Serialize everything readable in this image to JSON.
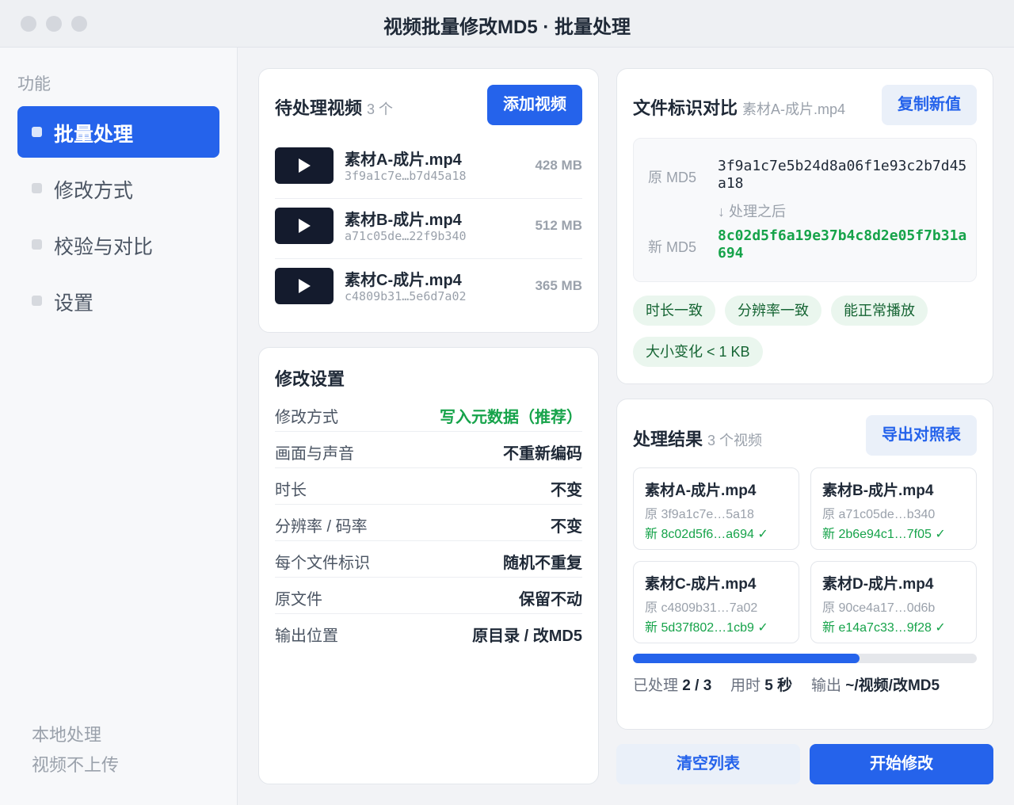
{
  "window": {
    "title": "视频批量修改MD5 · 批量处理"
  },
  "sidebar": {
    "heading": "功能",
    "items": [
      {
        "label": "批量处理",
        "active": true
      },
      {
        "label": "修改方式",
        "active": false
      },
      {
        "label": "校验与对比",
        "active": false
      },
      {
        "label": "设置",
        "active": false
      }
    ],
    "footer": [
      "本地处理",
      "视频不上传"
    ]
  },
  "queue": {
    "title": "待处理视频",
    "count": "3 个",
    "add_button": "添加视频",
    "videos": [
      {
        "name": "素材A-成片.mp4",
        "hash": "3f9a1c7e…b7d45a18",
        "size": "428 MB"
      },
      {
        "name": "素材B-成片.mp4",
        "hash": "a71c05de…22f9b340",
        "size": "512 MB"
      },
      {
        "name": "素材C-成片.mp4",
        "hash": "c4809b31…5e6d7a02",
        "size": "365 MB"
      }
    ]
  },
  "settings": {
    "title": "修改设置",
    "rows": [
      {
        "name": "修改方式",
        "value": "写入元数据（推荐）",
        "highlight": true
      },
      {
        "name": "画面与声音",
        "value": "不重新编码"
      },
      {
        "name": "时长",
        "value": "不变"
      },
      {
        "name": "分辨率 / 码率",
        "value": "不变"
      },
      {
        "name": "每个文件标识",
        "value": "随机不重复"
      },
      {
        "name": "原文件",
        "value": "保留不动"
      },
      {
        "name": "输出位置",
        "value": "原目录 / 改MD5"
      }
    ]
  },
  "compare": {
    "title": "文件标识对比",
    "file": "素材A-成片.mp4",
    "copy_button": "复制新值",
    "old_label": "原 MD5",
    "old_value": "3f9a1c7e5b24d8a06f1e93c2b7d45a18",
    "arrow_note": "↓ 处理之后",
    "new_label": "新 MD5",
    "new_value": "8c02d5f6a19e37b4c8d2e05f7b31a694",
    "checks": [
      "时长一致",
      "分辨率一致",
      "能正常播放",
      "大小变化 < 1 KB"
    ]
  },
  "results": {
    "title": "处理结果",
    "count": "3 个视频",
    "export_button": "导出对照表",
    "items": [
      {
        "name": "素材A-成片.mp4",
        "old": "原 3f9a1c7e…5a18",
        "new": "新 8c02d5f6…a694 ✓"
      },
      {
        "name": "素材B-成片.mp4",
        "old": "原 a71c05de…b340",
        "new": "新 2b6e94c1…7f05 ✓"
      },
      {
        "name": "素材C-成片.mp4",
        "old": "原 c4809b31…7a02",
        "new": "新 5d37f802…1cb9 ✓"
      },
      {
        "name": "素材D-成片.mp4",
        "old": "原 90ce4a17…0d6b",
        "new": "新 e14a7c33…9f28 ✓"
      }
    ],
    "progress": 0.66,
    "processed_label": "已处理",
    "processed": "2 / 3",
    "time_label": "用时",
    "time": "5 秒",
    "output_label": "输出",
    "output": "~/视频/改MD5"
  },
  "actions": {
    "clear": "清空列表",
    "start": "开始修改"
  },
  "colors": {
    "accent": "#2563eb",
    "success": "#16a34a",
    "chip_bg": "#eaf6ee"
  }
}
